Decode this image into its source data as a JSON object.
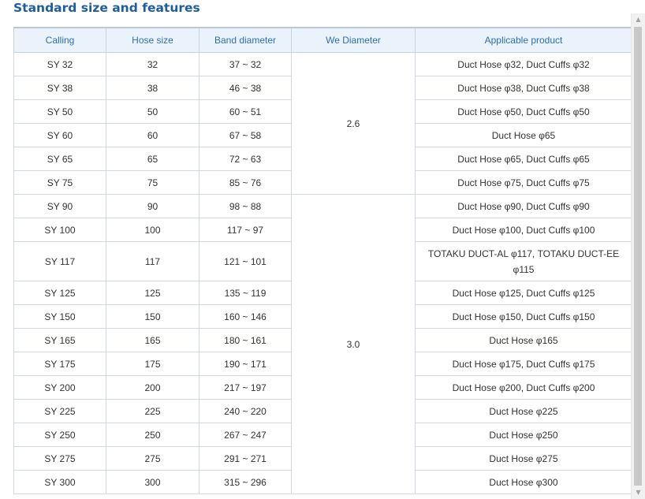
{
  "title": "Standard size and features",
  "table": {
    "headers": [
      "Calling",
      "Hose size",
      "Band diameter",
      "We Diameter",
      "Applicable product"
    ],
    "we_diameter_groups": [
      "2.6",
      "3.0"
    ],
    "rows": [
      {
        "calling": "SY 32",
        "hose": "32",
        "band": "37 ~ 32",
        "product": "Duct Hose φ32, Duct Cuffs φ32"
      },
      {
        "calling": "SY 38",
        "hose": "38",
        "band": "46 ~ 38",
        "product": "Duct Hose φ38, Duct Cuffs φ38"
      },
      {
        "calling": "SY 50",
        "hose": "50",
        "band": "60 ~ 51",
        "product": "Duct Hose φ50, Duct Cuffs φ50"
      },
      {
        "calling": "SY 60",
        "hose": "60",
        "band": "67 ~ 58",
        "product": "Duct Hose φ65"
      },
      {
        "calling": "SY 65",
        "hose": "65",
        "band": "72 ~ 63",
        "product": "Duct Hose φ65, Duct Cuffs φ65"
      },
      {
        "calling": "SY 75",
        "hose": "75",
        "band": "85 ~ 76",
        "product": "Duct Hose φ75, Duct Cuffs φ75"
      },
      {
        "calling": "SY 90",
        "hose": "90",
        "band": "98 ~ 88",
        "product": "Duct Hose φ90, Duct Cuffs φ90"
      },
      {
        "calling": "SY 100",
        "hose": "100",
        "band": "117 ~ 97",
        "product": "Duct Hose φ100, Duct Cuffs φ100"
      },
      {
        "calling": "SY 117",
        "hose": "117",
        "band": "121 ~ 101",
        "product": "TOTAKU DUCT-AL φ117, TOTAKU DUCT-EE φ115"
      },
      {
        "calling": "SY 125",
        "hose": "125",
        "band": "135 ~ 119",
        "product": "Duct Hose φ125, Duct Cuffs φ125"
      },
      {
        "calling": "SY 150",
        "hose": "150",
        "band": "160 ~ 146",
        "product": "Duct Hose φ150, Duct Cuffs φ150"
      },
      {
        "calling": "SY 165",
        "hose": "165",
        "band": "180 ~ 161",
        "product": "Duct Hose φ165"
      },
      {
        "calling": "SY 175",
        "hose": "175",
        "band": "190 ~ 171",
        "product": "Duct Hose φ175, Duct Cuffs φ175"
      },
      {
        "calling": "SY 200",
        "hose": "200",
        "band": "217 ~ 197",
        "product": "Duct Hose φ200, Duct Cuffs φ200"
      },
      {
        "calling": "SY 225",
        "hose": "225",
        "band": "240 ~ 220",
        "product": "Duct Hose φ225"
      },
      {
        "calling": "SY 250",
        "hose": "250",
        "band": "267 ~ 247",
        "product": "Duct Hose φ250"
      },
      {
        "calling": "SY 275",
        "hose": "275",
        "band": "291 ~ 271",
        "product": "Duct Hose φ275"
      },
      {
        "calling": "SY 300",
        "hose": "300",
        "band": "315 ~ 296",
        "product": "Duct Hose φ300"
      }
    ]
  },
  "scrollbar": {
    "up_icon": "triangle-up-icon",
    "down_icon": "triangle-down-icon"
  }
}
